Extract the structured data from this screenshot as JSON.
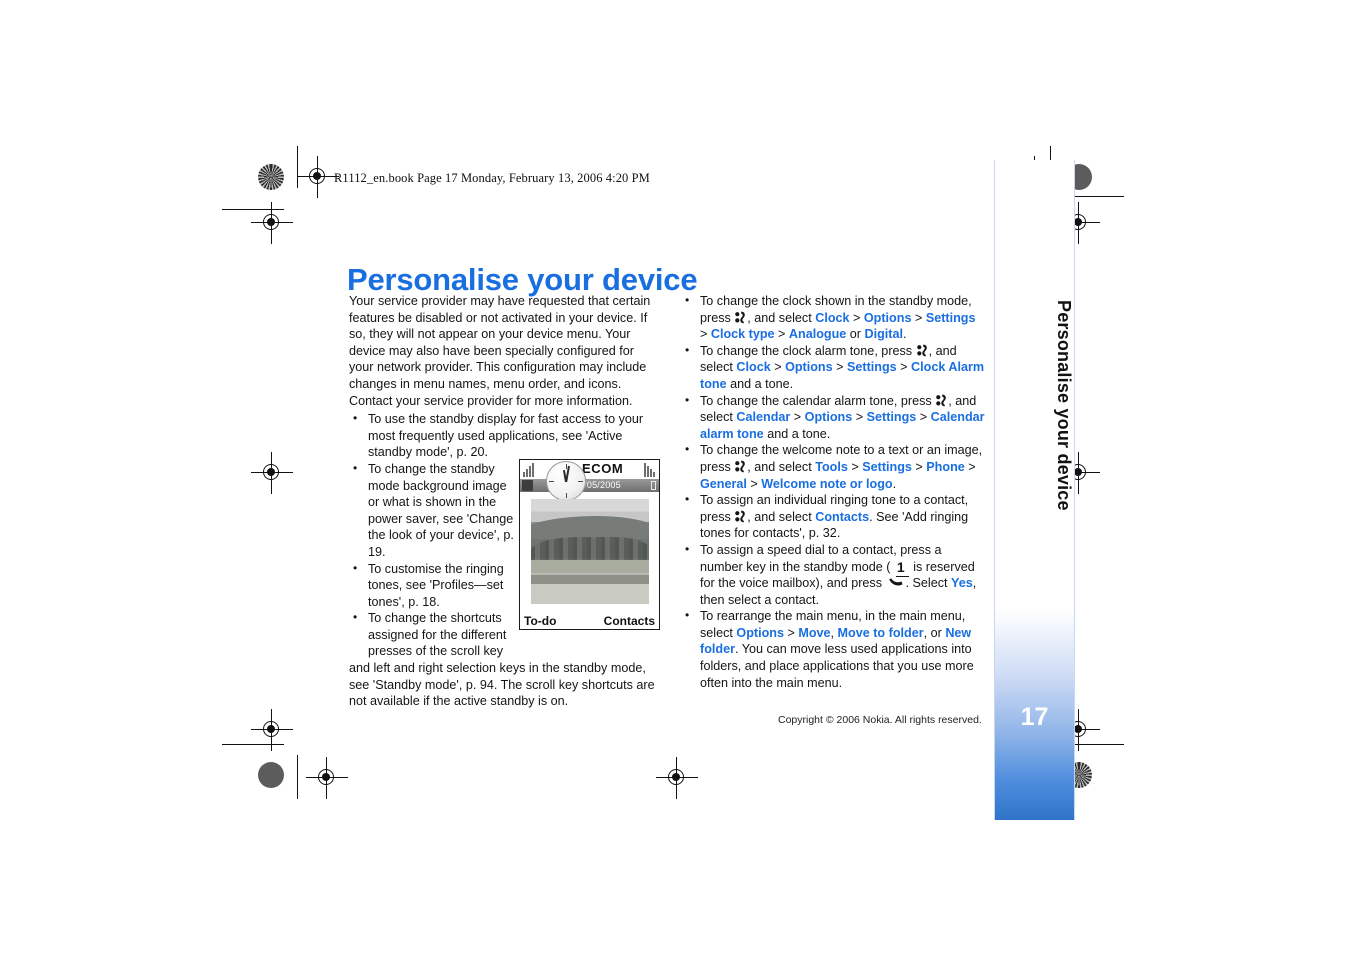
{
  "header": {
    "slug": "R1112_en.book  Page 17  Monday, February 13, 2006  4:20 PM"
  },
  "title": "Personalise your device",
  "left_column": {
    "intro": "Your service provider may have requested that certain features be disabled or not activated in your device. If so, they will not appear on your device menu. Your device may also have been specially configured for your network provider. This configuration may include changes in menu names, menu order, and icons. Contact your service provider for more information.",
    "bullets": [
      "To use the standby display for fast access to your most frequently used applications, see 'Active standby mode', p. 20.",
      "To change the standby mode background image or what is shown in the power saver, see 'Change the look of your device', p. 19.",
      "To customise the ringing tones, see 'Profiles—set tones', p. 18.",
      "To change the shortcuts assigned for the different presses of the scroll key and left and right selection keys in the standby mode, see 'Standby mode', p. 94. The scroll key shortcuts are not available if the active standby is on."
    ],
    "bullet4_narrow": "To change the shortcuts assigned for the different presses of the scroll key",
    "bullet4_wide": "and left and right selection keys in the standby mode, see 'Standby mode', p. 94. The scroll key shortcuts are not available if the active standby is on."
  },
  "phone_figure": {
    "operator": "TELECOM",
    "date": "Mo 02/05/2005",
    "softkey_left": "To-do",
    "softkey_right": "Contacts",
    "signal_icon": "signal-bars-icon",
    "battery_icon": "battery-icon",
    "clock_icon": "analogue-clock-icon",
    "wallpaper": "landscape-photo"
  },
  "right_column": {
    "bullets": [
      {
        "id": "clock-type",
        "parts": [
          {
            "t": "To change the clock shown in the standby mode, press ",
            "s": "plain"
          },
          {
            "t": "menu-key",
            "s": "menukey"
          },
          {
            "t": ", and select ",
            "s": "plain"
          },
          {
            "t": "Clock",
            "s": "link"
          },
          {
            "t": " > ",
            "s": "plain"
          },
          {
            "t": "Options",
            "s": "link"
          },
          {
            "t": " > ",
            "s": "plain"
          },
          {
            "t": "Settings",
            "s": "link"
          },
          {
            "t": " > ",
            "s": "plain"
          },
          {
            "t": "Clock type",
            "s": "link"
          },
          {
            "t": " > ",
            "s": "plain"
          },
          {
            "t": "Analogue",
            "s": "link"
          },
          {
            "t": " or ",
            "s": "plain"
          },
          {
            "t": "Digital",
            "s": "link"
          },
          {
            "t": ".",
            "s": "plain"
          }
        ]
      },
      {
        "id": "clock-alarm-tone",
        "parts": [
          {
            "t": "To change the clock alarm tone, press ",
            "s": "plain"
          },
          {
            "t": "menu-key",
            "s": "menukey"
          },
          {
            "t": ", and select ",
            "s": "plain"
          },
          {
            "t": "Clock",
            "s": "link"
          },
          {
            "t": " > ",
            "s": "plain"
          },
          {
            "t": "Options",
            "s": "link"
          },
          {
            "t": " > ",
            "s": "plain"
          },
          {
            "t": "Settings",
            "s": "link"
          },
          {
            "t": " > ",
            "s": "plain"
          },
          {
            "t": "Clock Alarm tone",
            "s": "link"
          },
          {
            "t": " and a tone.",
            "s": "plain"
          }
        ]
      },
      {
        "id": "calendar-alarm-tone",
        "parts": [
          {
            "t": "To change the calendar alarm tone, press ",
            "s": "plain"
          },
          {
            "t": "menu-key",
            "s": "menukey"
          },
          {
            "t": ", and select ",
            "s": "plain"
          },
          {
            "t": "Calendar",
            "s": "link"
          },
          {
            "t": " > ",
            "s": "plain"
          },
          {
            "t": "Options",
            "s": "link"
          },
          {
            "t": " > ",
            "s": "plain"
          },
          {
            "t": "Settings",
            "s": "link"
          },
          {
            "t": " > ",
            "s": "plain"
          },
          {
            "t": "Calendar alarm tone",
            "s": "link"
          },
          {
            "t": " and a tone.",
            "s": "plain"
          }
        ]
      },
      {
        "id": "welcome-note",
        "parts": [
          {
            "t": "To change the welcome note to a text or an image, press ",
            "s": "plain"
          },
          {
            "t": "menu-key",
            "s": "menukey"
          },
          {
            "t": ", and select ",
            "s": "plain"
          },
          {
            "t": "Tools",
            "s": "link"
          },
          {
            "t": " > ",
            "s": "plain"
          },
          {
            "t": "Settings",
            "s": "link"
          },
          {
            "t": " > ",
            "s": "plain"
          },
          {
            "t": "Phone",
            "s": "link"
          },
          {
            "t": " > ",
            "s": "plain"
          },
          {
            "t": "General",
            "s": "link"
          },
          {
            "t": " > ",
            "s": "plain"
          },
          {
            "t": "Welcome note or logo",
            "s": "link"
          },
          {
            "t": ".",
            "s": "plain"
          }
        ]
      },
      {
        "id": "individual-ringing-tone",
        "parts": [
          {
            "t": "To assign an individual ringing tone to a contact, press ",
            "s": "plain"
          },
          {
            "t": "menu-key",
            "s": "menukey"
          },
          {
            "t": ", and select ",
            "s": "plain"
          },
          {
            "t": "Contacts",
            "s": "link"
          },
          {
            "t": ". See 'Add ringing tones for contacts', p. 32.",
            "s": "plain"
          }
        ]
      },
      {
        "id": "speed-dial",
        "parts": [
          {
            "t": "To assign a speed dial to a contact, press a number key in the standby mode ( ",
            "s": "plain"
          },
          {
            "t": "1",
            "s": "numkey"
          },
          {
            "t": " is reserved for the voice mailbox), and press ",
            "s": "plain"
          },
          {
            "t": "call-key",
            "s": "callkey"
          },
          {
            "t": ". Select ",
            "s": "plain"
          },
          {
            "t": "Yes",
            "s": "link"
          },
          {
            "t": ", then select a contact.",
            "s": "plain"
          }
        ]
      },
      {
        "id": "rearrange-main-menu",
        "parts": [
          {
            "t": "To rearrange the main menu, in the main menu, select ",
            "s": "plain"
          },
          {
            "t": "Options",
            "s": "link"
          },
          {
            "t": " > ",
            "s": "plain"
          },
          {
            "t": "Move",
            "s": "link"
          },
          {
            "t": ", ",
            "s": "plain"
          },
          {
            "t": "Move to folder",
            "s": "link"
          },
          {
            "t": ", or ",
            "s": "plain"
          },
          {
            "t": "New folder",
            "s": "link"
          },
          {
            "t": ". You can move less used applications into folders, and place applications that you use more often into the main menu.",
            "s": "plain"
          }
        ]
      }
    ]
  },
  "footer": {
    "copyright": "Copyright © 2006 Nokia. All rights reserved."
  },
  "side_tab": {
    "label": "Personalise your device",
    "page_number": "17"
  },
  "colors": {
    "link_blue": "#1a6fe0",
    "title_blue": "#1a6fe0",
    "tab_blue": "#2f74c9",
    "text": "#151515"
  }
}
